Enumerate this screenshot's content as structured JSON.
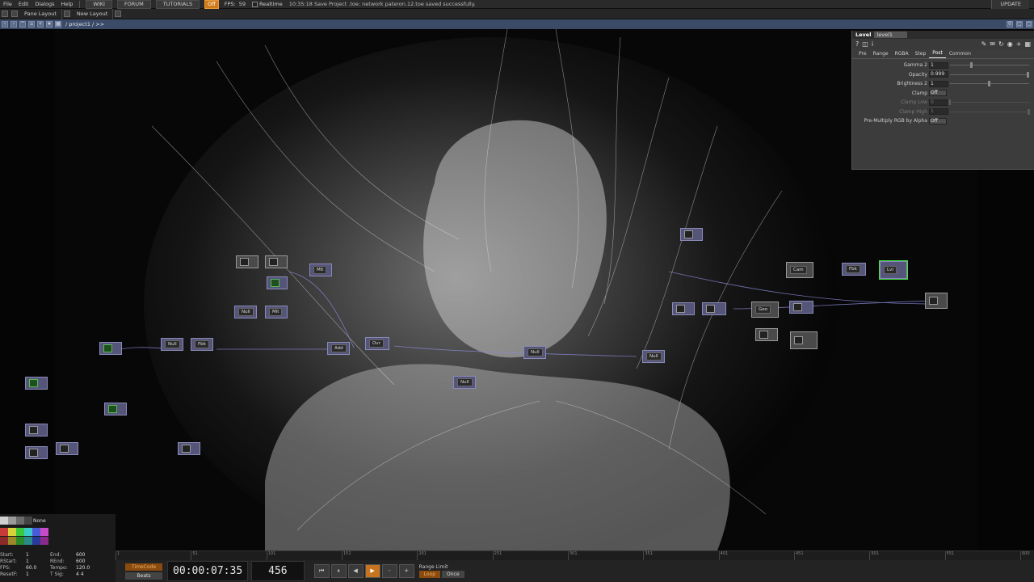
{
  "menu": {
    "items": [
      "File",
      "Edit",
      "Dialogs",
      "Help"
    ],
    "wiki": "WIKI",
    "forum": "FORUM",
    "tutorials": "TUTORIALS",
    "off": "Off",
    "fps_label": "FPS:",
    "fps_value": "59",
    "realtime": "Realtime",
    "status": "10:35:18 Save Project .toe: network pateron.12.toe saved successfully.",
    "update": "UPDATE"
  },
  "panes": {
    "pane_layout": "Pane Layout",
    "new_layout": "New Layout"
  },
  "path": "/ project1 / >>",
  "nodes": [
    {
      "label": "Mlt"
    },
    {
      "label": "Null"
    },
    {
      "label": "Mlt"
    },
    {
      "label": "Null"
    },
    {
      "label": "Fbk"
    },
    {
      "label": "Add"
    },
    {
      "label": "Ovr"
    },
    {
      "label": "Null"
    },
    {
      "label": "Null"
    },
    {
      "label": "Null"
    },
    {
      "label": "Cam"
    },
    {
      "label": "Fbk"
    },
    {
      "label": "Lvl"
    },
    {
      "label": "Geo"
    }
  ],
  "params": {
    "op_type": "Level",
    "op_name": "level1",
    "tabs": [
      "Pre",
      "Range",
      "RGBA",
      "Step",
      "Post",
      "Common"
    ],
    "active_tab": "Post",
    "rows": [
      {
        "label": "Gamma 2",
        "value": "1",
        "slider": 0.28,
        "dim": false
      },
      {
        "label": "Opacity",
        "value": "0.999",
        "slider": 0.99,
        "dim": false
      },
      {
        "label": "Brightness 2",
        "value": "1",
        "slider": 0.5,
        "dim": false
      },
      {
        "label": "Clamp",
        "value": "Off",
        "dim": false,
        "toggle": true
      },
      {
        "label": "Clamp Low",
        "value": "0",
        "slider": 0.0,
        "dim": true
      },
      {
        "label": "Clamp High",
        "value": "1",
        "slider": 1.0,
        "dim": true
      },
      {
        "label": "Pre-Multiply RGB by Alpha",
        "value": "Off",
        "dim": false,
        "toggle": true
      }
    ]
  },
  "timeline": {
    "ticks": [
      "1",
      "51",
      "101",
      "151",
      "201",
      "251",
      "301",
      "351",
      "401",
      "451",
      "501",
      "551",
      "600"
    ],
    "timecode_label": "TimeCode",
    "beats_label": "Beats",
    "timecode": "00:00:07:35",
    "frame": "456",
    "range_limit": "Range Limit",
    "loop": "Loop",
    "once": "Once"
  },
  "timeinfo": {
    "rows": [
      {
        "k": "Start:",
        "v": "1",
        "k2": "End:",
        "v2": "600"
      },
      {
        "k": "RStart:",
        "v": "1",
        "k2": "REnd:",
        "v2": "600"
      },
      {
        "k": "FPS:",
        "v": "60.0",
        "k2": "Tempo:",
        "v2": "120.0"
      },
      {
        "k": "ResetF:",
        "v": "1",
        "k2": "T Sig:",
        "v2": "4    4"
      }
    ],
    "palette_none": "None"
  },
  "colors": {
    "accent_orange": "#d07a1a",
    "path_bar": "#3b4a66",
    "node_purple": "#55557a",
    "selected_green": "#3ce63c"
  }
}
